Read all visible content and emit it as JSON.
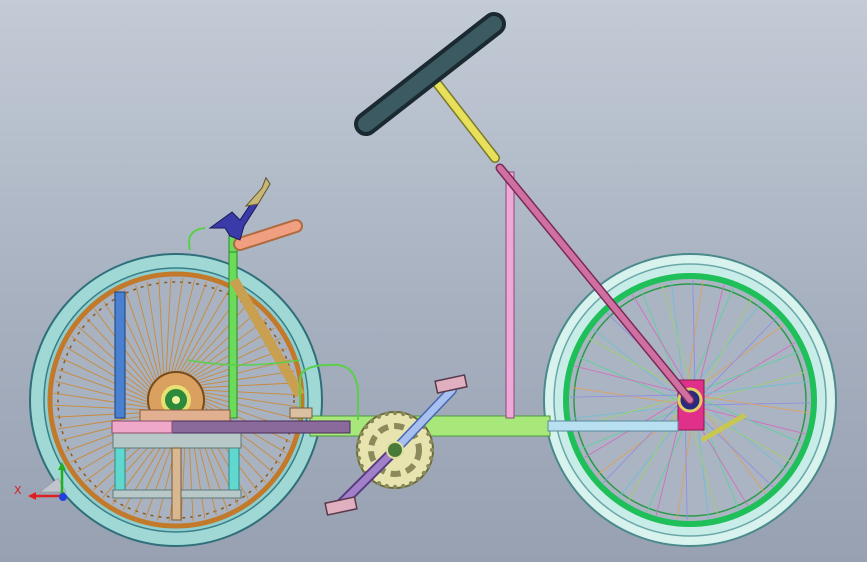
{
  "triad": {
    "x_axis_label": "X",
    "x_axis_color": "#e02020",
    "y_axis_color": "#20b020",
    "z_axis_color": "#2040e0"
  },
  "model": {
    "frame_color": "#a8e87a",
    "tire_color": "#9fd8d4",
    "steering_wheel_color": "#2e4a50",
    "steering_column_color": "#e8e05a",
    "steering_rod_color": "#d070a0"
  },
  "icons": {
    "triad": "coordinate-triad-icon"
  }
}
